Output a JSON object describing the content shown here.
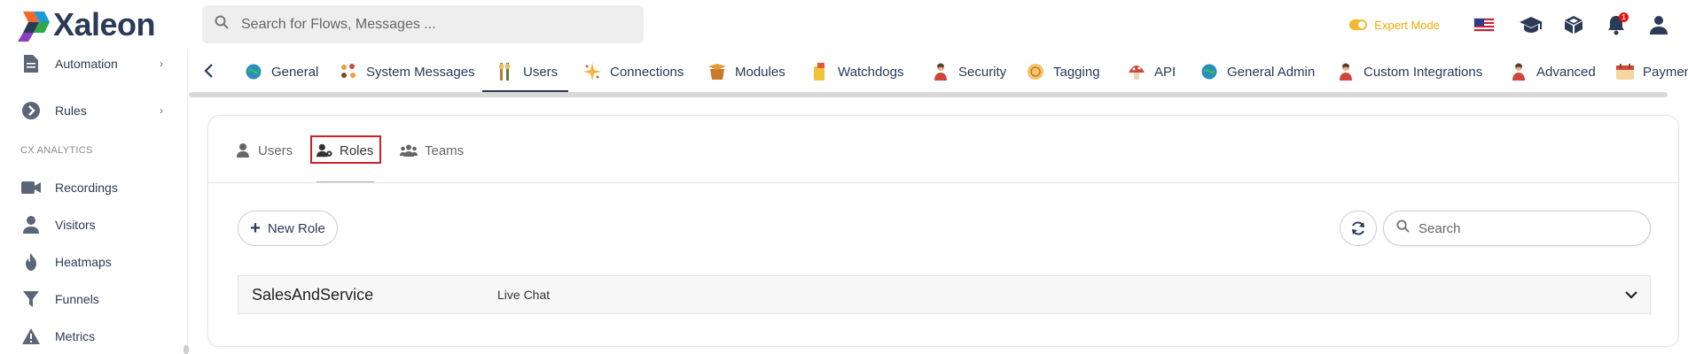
{
  "app": {
    "logo_text": "Xaleon",
    "search_placeholder": "Search for Flows, Messages ...",
    "expert_mode_label": "Expert Mode",
    "notification_count": "1"
  },
  "sidebar": {
    "items": [
      {
        "label": "Automation",
        "icon": "file-icon",
        "has_chevron": true
      },
      {
        "label": "Rules",
        "icon": "arrow-circle-icon",
        "has_chevron": true
      }
    ],
    "section_title": "CX ANALYTICS",
    "analytics_items": [
      {
        "label": "Recordings",
        "icon": "video-icon"
      },
      {
        "label": "Visitors",
        "icon": "user-icon"
      },
      {
        "label": "Heatmaps",
        "icon": "fire-icon"
      },
      {
        "label": "Funnels",
        "icon": "funnel-icon"
      },
      {
        "label": "Metrics",
        "icon": "warning-icon"
      }
    ]
  },
  "tabs": [
    {
      "label": "General",
      "icon": "globe-icon",
      "active": false
    },
    {
      "label": "System Messages",
      "icon": "bulbs-icon",
      "active": false
    },
    {
      "label": "Users",
      "icon": "users-icon",
      "active": true
    },
    {
      "label": "Connections",
      "icon": "sparkle-icon",
      "active": false
    },
    {
      "label": "Modules",
      "icon": "box-icon",
      "active": false
    },
    {
      "label": "Watchdogs",
      "icon": "badge-icon",
      "active": false
    },
    {
      "label": "Security",
      "icon": "person-icon",
      "active": false
    },
    {
      "label": "Tagging",
      "icon": "tag-icon",
      "active": false
    },
    {
      "label": "API",
      "icon": "mushroom-icon",
      "active": false
    },
    {
      "label": "General Admin",
      "icon": "globe-icon",
      "active": false
    },
    {
      "label": "Custom Integrations",
      "icon": "person-icon",
      "active": false
    },
    {
      "label": "Advanced",
      "icon": "person-icon",
      "active": false
    },
    {
      "label": "Paymen",
      "icon": "calendar-icon",
      "active": false
    }
  ],
  "subtabs": [
    {
      "label": "Users",
      "icon": "user-icon",
      "active": false
    },
    {
      "label": "Roles",
      "icon": "user-gear-icon",
      "active": true
    },
    {
      "label": "Teams",
      "icon": "team-icon",
      "active": false
    }
  ],
  "toolbar": {
    "new_role_label": "New Role",
    "search_placeholder": "Search"
  },
  "roles": [
    {
      "name": "SalesAndService",
      "type": "Live Chat"
    }
  ],
  "colors": {
    "brand_navy": "#2b3a56",
    "expert_mode": "#f0a800",
    "highlight_box": "#cc1f2a"
  }
}
